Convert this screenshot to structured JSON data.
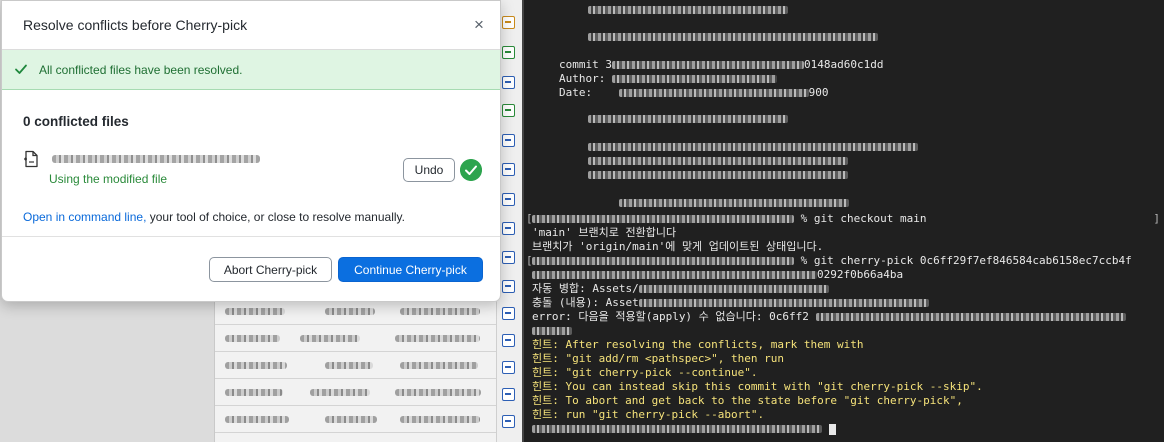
{
  "dialog": {
    "title": "Resolve conflicts before Cherry-pick",
    "close_symbol": "×",
    "banner": "All conflicted files have been resolved.",
    "conflict_count": "0 conflicted files",
    "file": {
      "status": "Using the modified file",
      "undo_label": "Undo"
    },
    "hint": {
      "link": "Open in command line,",
      "rest": " your tool of choice, or close to resolve manually."
    },
    "abort_label": "Abort Cherry-pick",
    "continue_label": "Continue Cherry-pick"
  },
  "terminal": {
    "commit_label": "commit 3",
    "commit_tail": "0148ad60c1dd",
    "author_label": "Author:",
    "date_label": "Date:",
    "date_tail": "900",
    "checkout_cmd": "% git checkout main",
    "switched": "'main' 브랜치로 전환합니다",
    "uptodate": "브랜치가 'origin/main'에 맞게 업데이트된 상태입니다.",
    "cherrypick_cmd": "% git cherry-pick 0c6ff29f7ef846584cab6158ec7ccb4f",
    "hash_tail": "0292f0b66a4ba",
    "automerge": "자동 병합: Assets/",
    "conflict": "충돌 (내용): Asset",
    "error": "error: 다음을 적용할(apply) 수 없습니다: 0c6ff2",
    "hint1": "힌트: After resolving the conflicts, mark them with",
    "hint2": "힌트: \"git add/rm <pathspec>\", then run",
    "hint3": "힌트: \"git cherry-pick --continue\".",
    "hint4": "힌트: You can instead skip this commit with \"git cherry-pick --skip\".",
    "hint5": "힌트: To abort and get back to the state before \"git cherry-pick\",",
    "hint6": "힌트: run \"git cherry-pick --abort\"."
  },
  "colors": {
    "accent": "#0b6fe0",
    "success": "#2da44e",
    "banner_bg": "#dff5e3",
    "terminal_bg": "#202020",
    "terminal_hint": "#f5e27a"
  },
  "icons": [
    "close-icon",
    "checkmark-icon",
    "file-diff-icon",
    "resolved-check-icon"
  ]
}
